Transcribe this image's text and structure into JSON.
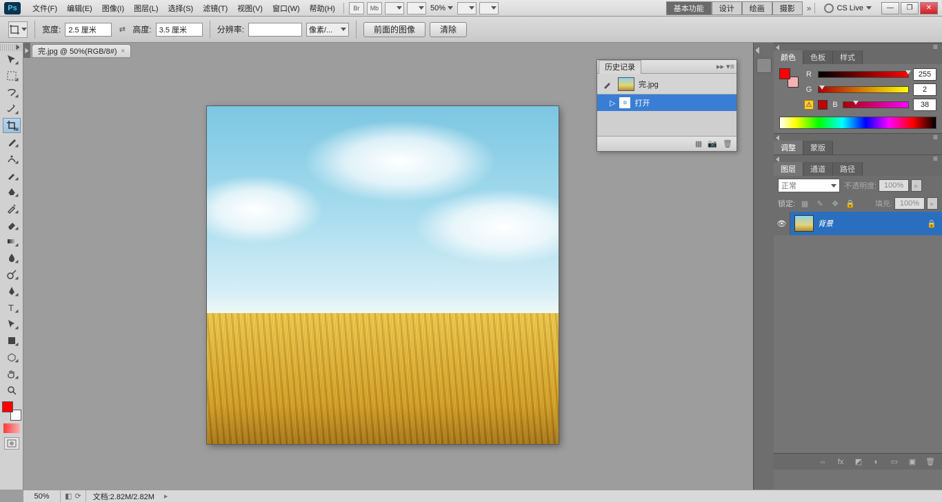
{
  "app_icon": "Ps",
  "menus": [
    "文件(F)",
    "编辑(E)",
    "图像(I)",
    "图层(L)",
    "选择(S)",
    "滤镜(T)",
    "视图(V)",
    "窗口(W)",
    "帮助(H)"
  ],
  "menubar_icons": [
    "Br",
    "Mb"
  ],
  "menubar_zoom": "50%",
  "workspaces": {
    "items": [
      "基本功能",
      "设计",
      "绘画",
      "摄影"
    ],
    "active": "基本功能",
    "more": "»"
  },
  "cslive": "CS Live",
  "win_controls": {
    "min": "—",
    "max": "❐",
    "close": "✕"
  },
  "options": {
    "width_label": "宽度:",
    "width_value": "2.5 厘米",
    "height_label": "高度:",
    "height_value": "3.5 厘米",
    "res_label": "分辨率:",
    "res_value": "",
    "res_unit": "像素/...",
    "btn_front": "前面的图像",
    "btn_clear": "清除",
    "swap": "⇄"
  },
  "document": {
    "tab_title": "完.jpg @ 50%(RGB/8#)",
    "close": "×"
  },
  "history": {
    "title": "历史记录",
    "doc_name": "完.jpg",
    "state": "打开",
    "ctrl_collapse": "▸▸",
    "ctrl_menu": "▾≡"
  },
  "color_panel": {
    "tabs": [
      "颜色",
      "色板",
      "样式"
    ],
    "channels": [
      {
        "label": "R",
        "value": "255",
        "pos": 100
      },
      {
        "label": "G",
        "value": "2",
        "pos": 1
      },
      {
        "label": "B",
        "value": "38",
        "pos": 15
      }
    ],
    "warn": "⚠"
  },
  "adjust_panel": {
    "tabs": [
      "调整",
      "蒙版"
    ]
  },
  "layers_panel": {
    "tabs": [
      "图层",
      "通道",
      "路径"
    ],
    "blend_mode": "正常",
    "opacity_label": "不透明度:",
    "opacity_value": "100%",
    "lock_label": "锁定:",
    "fill_label": "填充:",
    "fill_value": "100%",
    "layer_name": "背景",
    "eye": "👁",
    "lock": "🔒"
  },
  "statusbar": {
    "zoom": "50%",
    "doc": "文档:2.82M/2.82M",
    "arrow": "▸"
  }
}
